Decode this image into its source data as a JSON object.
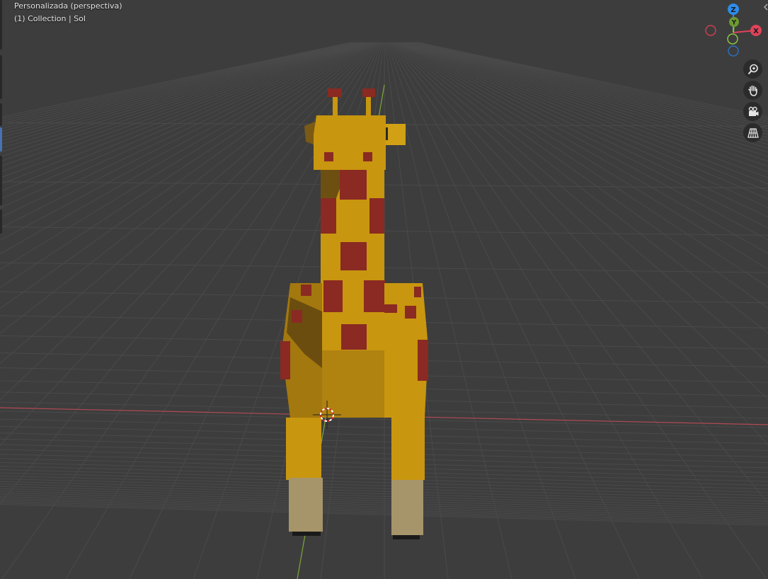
{
  "viewport": {
    "view_name": "Personalizada (perspectiva)",
    "collection_info": "(1) Collection | Sol"
  },
  "gizmo": {
    "axis_z": "Z",
    "axis_y": "Y",
    "axis_x": "X",
    "color_x": "#e0435a",
    "color_y": "#8bc43f",
    "color_z": "#2d8ceb"
  },
  "navigation": {
    "buttons": [
      "zoom-icon",
      "hand-pan-icon",
      "camera-icon",
      "grid-perspective-icon"
    ]
  },
  "colors": {
    "background": "#3d3d3d",
    "grid": "#4a4a4a",
    "x_axis_line": "#b34a55",
    "y_axis_line": "#7fa83a",
    "giraffe_body": "#c8960f",
    "giraffe_spots": "#7a2a1c",
    "giraffe_hooves": "#a6956a"
  }
}
